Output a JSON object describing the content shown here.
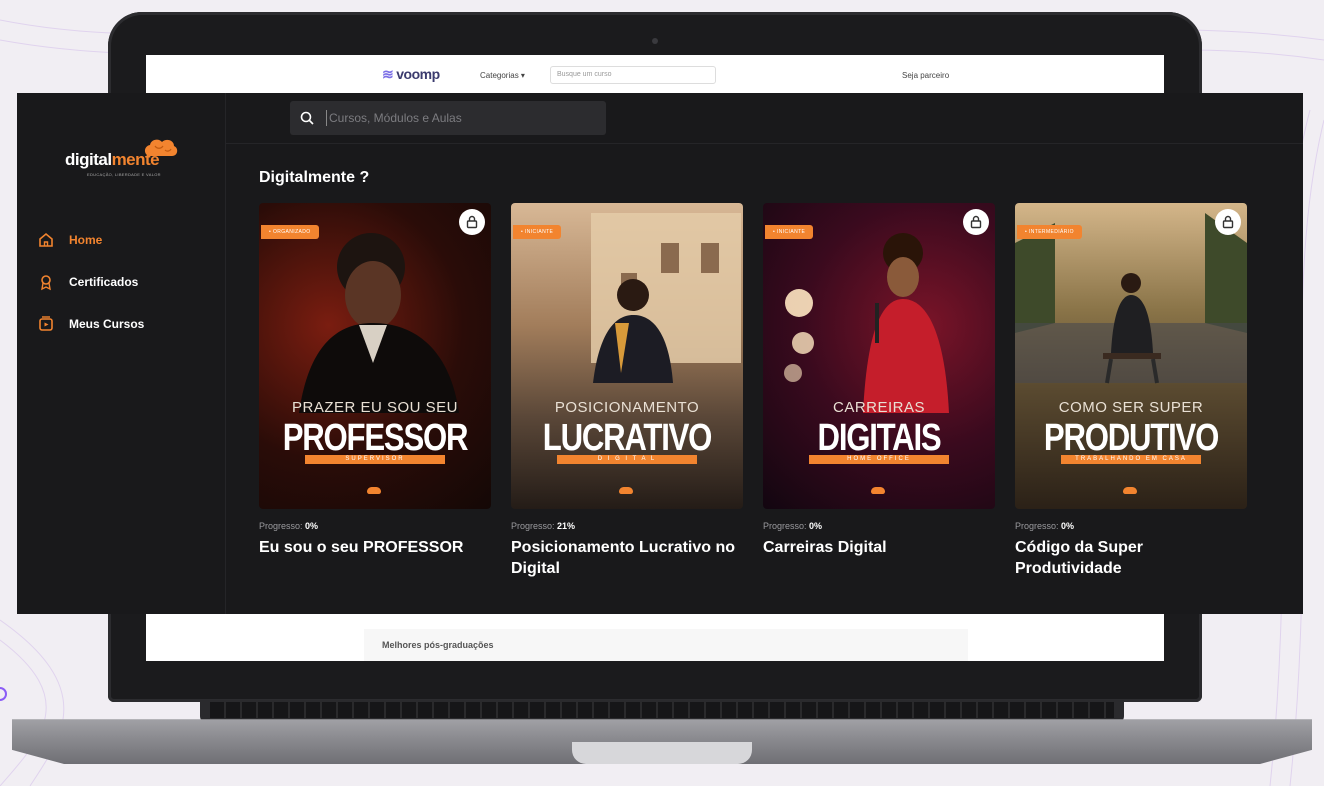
{
  "voomp": {
    "brand": "voomp",
    "categories_label": "Categorias ▾",
    "search_placeholder": "Busque um curso",
    "right_link": "Seja parceiro",
    "bottom_section": "Melhores pós-graduações"
  },
  "app": {
    "logo": {
      "part1": "digital",
      "part2": "mente",
      "tagline": "EDUCAÇÃO, LIBERDADE E VALOR"
    },
    "nav": [
      {
        "label": "Home",
        "icon": "home-icon",
        "active": true
      },
      {
        "label": "Certificados",
        "icon": "certificate-icon",
        "active": false
      },
      {
        "label": "Meus Cursos",
        "icon": "courses-icon",
        "active": false
      }
    ],
    "search": {
      "placeholder": "Cursos, Módulos e Aulas"
    },
    "section_title": "Digitalmente ?",
    "progress_label": "Progresso:",
    "courses": [
      {
        "title": "Eu sou o seu PROFESSOR",
        "progress": "0%",
        "cover_line1": "PRAZER EU SOU SEU",
        "cover_line2": "PROFESSOR",
        "cover_bar": "SUPERVISOR",
        "badge": "• ORGANIZADO",
        "locked": true,
        "colors": [
          "#2a0c08",
          "#7a1d10",
          "#1a0f0c"
        ]
      },
      {
        "title": "Posicionamento Lucrativo no Digital",
        "progress": "21%",
        "cover_line1": "POSICIONAMENTO",
        "cover_line2": "LUCRATIVO",
        "cover_bar": "D I G I T A L",
        "badge": "• INICIANTE",
        "locked": false,
        "colors": [
          "#c9a07a",
          "#8a6a4e",
          "#2c231e"
        ]
      },
      {
        "title": "Carreiras Digital",
        "progress": "0%",
        "cover_line1": "CARREIRAS",
        "cover_line2": "DIGITAIS",
        "cover_bar": "HOME OFFICE",
        "badge": "• INICIANTE",
        "locked": true,
        "colors": [
          "#3a0a1e",
          "#6a1024",
          "#150810"
        ]
      },
      {
        "title": "Código da Super Produtividade",
        "progress": "0%",
        "cover_line1": "COMO SER SUPER",
        "cover_line2": "PRODUTIVO",
        "cover_bar": "TRABALHANDO EM CASA",
        "badge": "• INTERMEDIÁRIO",
        "locked": true,
        "colors": [
          "#b98a55",
          "#6e5a3a",
          "#2b2117"
        ]
      }
    ]
  },
  "colors": {
    "accent": "#f2842f",
    "panel": "#19191b",
    "search_bg": "#2c2c2f"
  }
}
